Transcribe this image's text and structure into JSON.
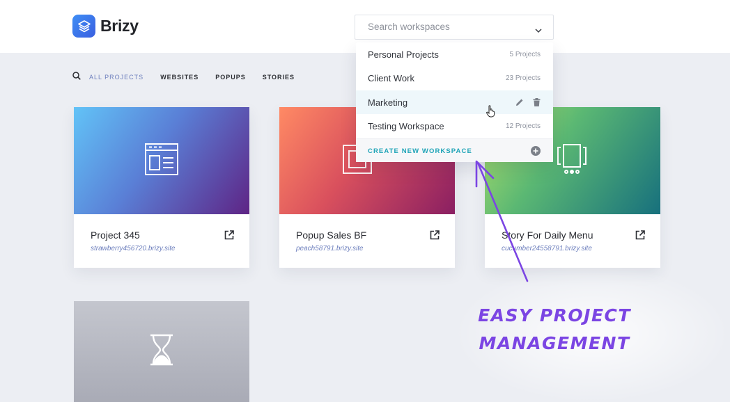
{
  "app": {
    "name": "Brizy",
    "logo_icon": "layers-icon",
    "brand_color": "#3a6ee8"
  },
  "search": {
    "placeholder": "Search workspaces"
  },
  "workspaces": [
    {
      "name": "Personal Projects",
      "count": "5 Projects"
    },
    {
      "name": "Client Work",
      "count": "23 Projects"
    },
    {
      "name": "Marketing",
      "count": "",
      "actions": [
        "pencil-icon",
        "trash-icon"
      ]
    },
    {
      "name": "Testing Workspace",
      "count": "12 Projects"
    }
  ],
  "create_workspace": {
    "label": "CREATE NEW WORKSPACE",
    "accent": "#21a5b8"
  },
  "filters": {
    "all": "ALL PROJECTS",
    "websites": "WEBSITES",
    "popups": "POPUPS",
    "stories": "STORIES"
  },
  "projects": [
    {
      "title": "Project 345",
      "url": "strawberry456720.brizy.site",
      "icon": "website-layout-icon"
    },
    {
      "title": "Popup Sales BF",
      "url": "peach58791.brizy.site",
      "icon": "popup-icon"
    },
    {
      "title": "Story For Daily Menu",
      "url": "cucumber24558791.brizy.site",
      "icon": "story-icon"
    },
    {
      "title": "",
      "url": "",
      "icon": "hourglass-icon"
    }
  ],
  "annotation": {
    "line1": "EASY PROJECT",
    "line2": "MANAGEMENT",
    "color": "#7b45e3"
  }
}
